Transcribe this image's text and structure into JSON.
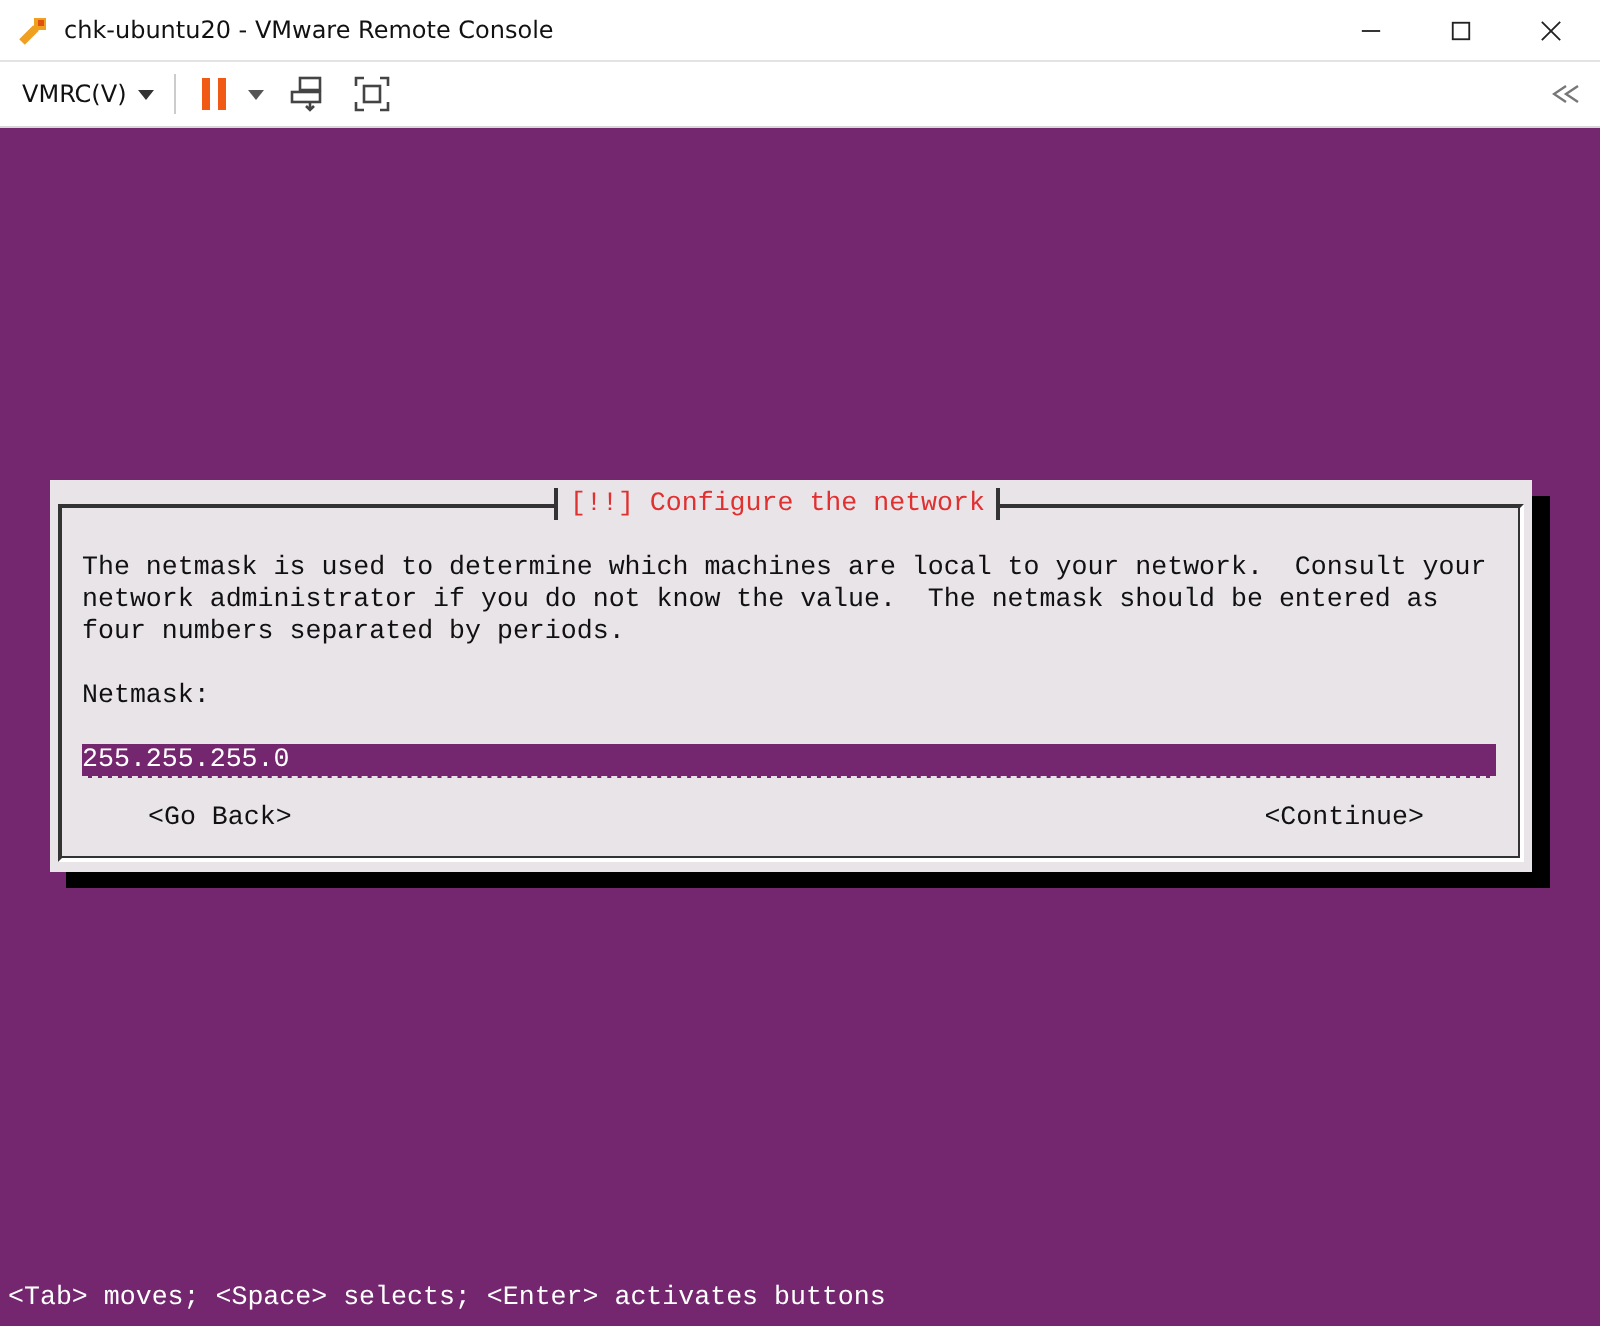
{
  "window": {
    "title": "chk-ubuntu20 - VMware Remote Console"
  },
  "toolbar": {
    "menu": "VMRC(V)"
  },
  "dialog": {
    "title": "[!!] Configure the network",
    "message": "The netmask is used to determine which machines are local to your network.  Consult your\nnetwork administrator if you do not know the value.  The netmask should be entered as\nfour numbers separated by periods.",
    "field_label": "Netmask:",
    "field_value": "255.255.255.0",
    "buttons": [
      {
        "label": "<Go Back>"
      },
      {
        "label": "<Continue>"
      }
    ]
  },
  "status_bar": "<Tab> moves; <Space> selects; <Enter> activates buttons"
}
